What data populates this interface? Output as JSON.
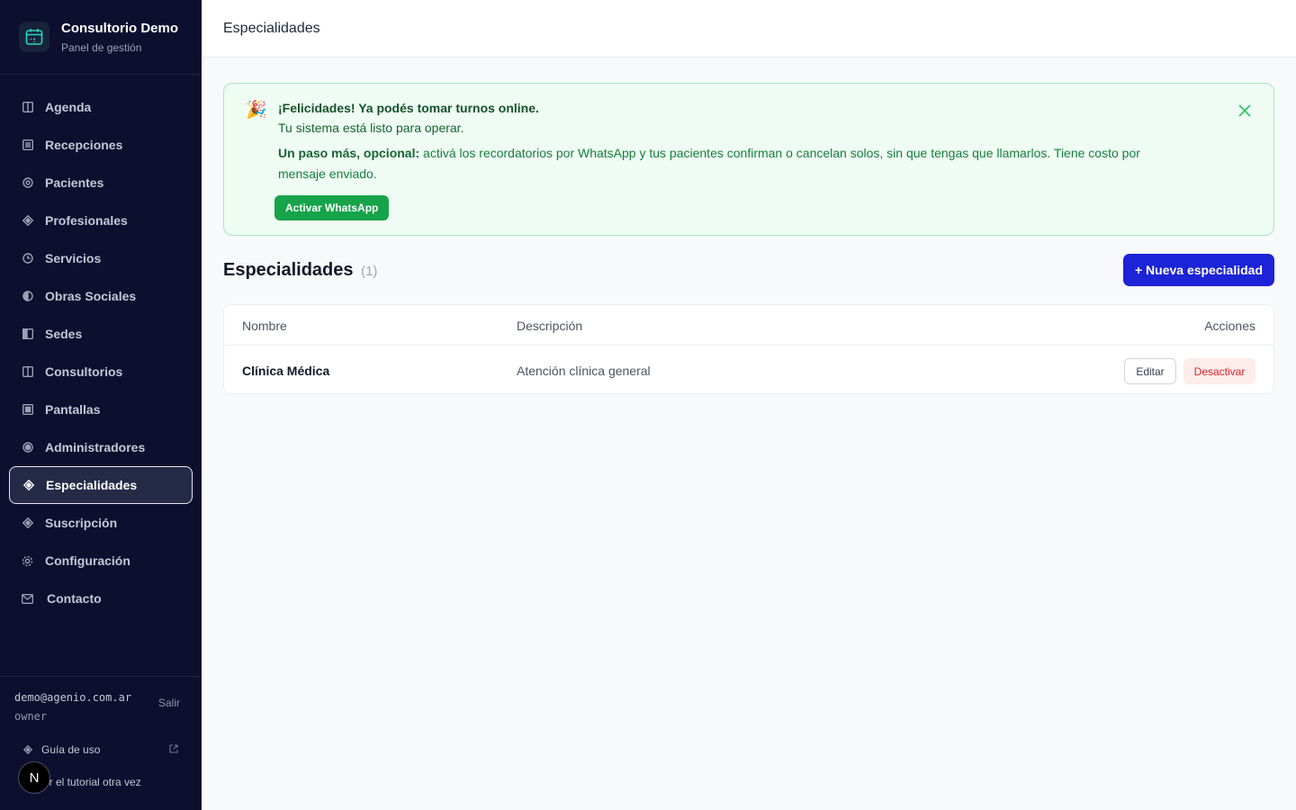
{
  "brand": {
    "title": "Consultorio Demo",
    "subtitle": "Panel de gestión",
    "icon": "calendar-icon"
  },
  "sidebar": {
    "items": [
      {
        "label": "Agenda",
        "icon": "columns-icon"
      },
      {
        "label": "Recepciones",
        "icon": "list-icon"
      },
      {
        "label": "Pacientes",
        "icon": "circle-icon"
      },
      {
        "label": "Profesionales",
        "icon": "diamond-icon"
      },
      {
        "label": "Servicios",
        "icon": "clock-icon"
      },
      {
        "label": "Obras Sociales",
        "icon": "half-circle-icon"
      },
      {
        "label": "Sedes",
        "icon": "panel-icon"
      },
      {
        "label": "Consultorios",
        "icon": "columns-icon"
      },
      {
        "label": "Pantallas",
        "icon": "screen-icon"
      },
      {
        "label": "Administradores",
        "icon": "target-icon"
      },
      {
        "label": "Especialidades",
        "icon": "diamond-icon",
        "active": true
      },
      {
        "label": "Suscripción",
        "icon": "diamond-icon"
      },
      {
        "label": "Configuración",
        "icon": "gear-icon"
      },
      {
        "label": "Contacto",
        "icon": "mail-icon"
      }
    ]
  },
  "footer": {
    "email": "demo@agenio.com.ar",
    "role": "owner",
    "logout": "Salir",
    "guide": "Guía de uso",
    "tutorial": "er el tutorial otra vez",
    "badge": "N"
  },
  "topbar": {
    "title": "Especialidades"
  },
  "banner": {
    "emoji": "🎉",
    "title": "¡Felicidades! Ya podés tomar turnos online.",
    "line2": "Tu sistema está listo para operar.",
    "text_bold": "Un paso más, opcional:",
    "text": " activá los recordatorios por WhatsApp y tus pacientes confirman o cancelan solos, sin que tengas que llamarlos. Tiene costo por mensaje enviado.",
    "button": "Activar WhatsApp"
  },
  "section": {
    "title": "Especialidades",
    "count": "(1)",
    "new_button": "+ Nueva especialidad"
  },
  "table": {
    "headers": {
      "name": "Nombre",
      "description": "Descripción",
      "actions": "Acciones"
    },
    "rows": [
      {
        "name": "Clínica Médica",
        "description": "Atención clínica general",
        "edit": "Editar",
        "deactivate": "Desactivar"
      }
    ]
  },
  "colors": {
    "sidebar_bg": "#0c0f2e",
    "primary": "#1d23d6",
    "success": "#16a34a",
    "danger": "#dc2626"
  }
}
